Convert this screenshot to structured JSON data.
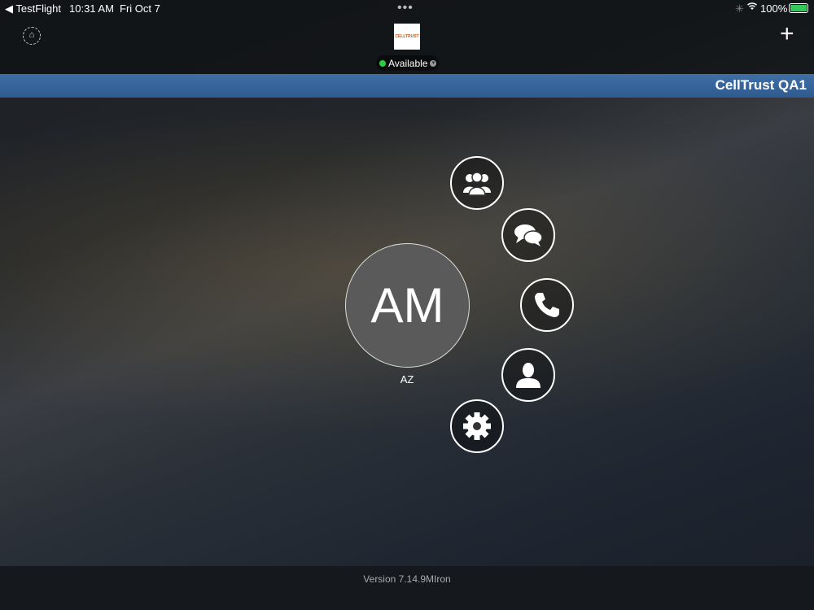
{
  "status_bar": {
    "back_app": "TestFlight",
    "time": "10:31 AM",
    "date": "Fri Oct 7",
    "battery": "100%"
  },
  "header": {
    "logo_text": "CELLTRUST",
    "presence": "Available",
    "presence_color": "#2ecc40"
  },
  "banner": {
    "title": "CellTrust QA1"
  },
  "profile": {
    "initials": "AM",
    "name": "AZ"
  },
  "menu": [
    {
      "icon": "groups-icon"
    },
    {
      "icon": "chat-icon"
    },
    {
      "icon": "phone-icon"
    },
    {
      "icon": "contact-icon"
    },
    {
      "icon": "settings-icon"
    }
  ],
  "footer": {
    "version": "Version 7.14.9MIron"
  }
}
